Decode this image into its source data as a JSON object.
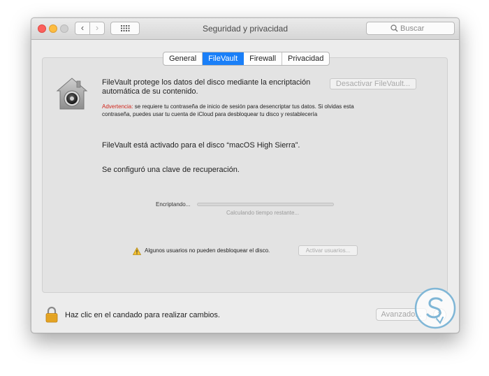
{
  "window": {
    "title": "Seguridad y privacidad"
  },
  "toolbar": {
    "back_glyph": "‹",
    "forward_glyph": "›",
    "grid_icon": "grid-icon",
    "search_placeholder": "Buscar"
  },
  "tabs": [
    {
      "label": "General",
      "active": false
    },
    {
      "label": "FileVault",
      "active": true
    },
    {
      "label": "Firewall",
      "active": false
    },
    {
      "label": "Privacidad",
      "active": false
    }
  ],
  "filevault": {
    "intro_line1": "FileVault protege los datos del disco mediante la encriptación",
    "intro_line2": "automática de su contenido.",
    "deactivate_button": "Desactivar FileVault...",
    "warning_label": "Advertencia:",
    "warning_text_line1": " se requiere tu contraseña de inicio de sesión para desencriptar tus datos. Si olvidas esta",
    "warning_text_line2": "contraseña, puedes usar tu cuenta de iCloud para desbloquear tu disco y restablecería",
    "status_enabled": "FileVault está activado para el disco “macOS High Sierra”.",
    "status_recovery": "Se configuró una clave de recuperación.",
    "encrypting_label": "Encriptando...",
    "encrypting_progress": 0,
    "calculating_text": "Calculando tiempo restante...",
    "users_warning": "Algunos usuarios no pueden desbloquear el disco.",
    "activate_users_button": "Activar usuarios..."
  },
  "footer": {
    "lock_text": "Haz clic en el candado para realizar cambios.",
    "advanced_button": "Avanzado...",
    "help_glyph": "?"
  },
  "colors": {
    "accent": "#1a7ff8",
    "warning_red": "#d0281e",
    "close": "#fc605c",
    "minimize": "#fdbc40"
  }
}
